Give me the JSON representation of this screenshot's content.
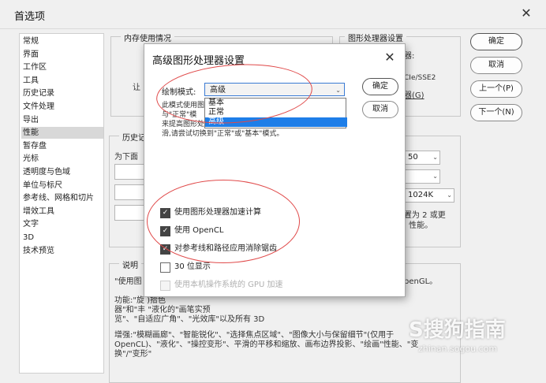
{
  "prefs": {
    "title": "首选项",
    "sidebar": [
      "常规",
      "界面",
      "工作区",
      "工具",
      "历史记录",
      "文件处理",
      "导出",
      "性能",
      "暂存盘",
      "光标",
      "透明度与色域",
      "单位与标尺",
      "参考线、网格和切片",
      "增效工具",
      "文字",
      "3D",
      "技术预览"
    ],
    "selected_index": 7,
    "groups": {
      "memory": "内存使用情况",
      "history": "历史记",
      "gpu": "图形处理器设置",
      "desc": "说明"
    },
    "buttons": {
      "ok": "确定",
      "cancel": "取消",
      "prev": "上一个(P)",
      "next": "下一个(N)"
    },
    "ghost_texts": {
      "gpu_tail": "器:",
      "cie": "CIe/SSE2",
      "settings_link": "器(G)",
      "let": "让",
      "for_below": "为下面",
      "val_50": "50",
      "val_1024": "1024K",
      "set_2": "置为 2 或更",
      "perf": "J 性能。",
      "opengl_tail": "penGL。",
      "desc_1": "\"使用图",
      "desc_2": "功能:\"旋                                                           )拾色",
      "desc_3": "器\"和\"丰                                                  \"液化的\"画笔实预",
      "desc_4": "览\"、\"自适应广角\"、\"光效库\"以及所有 3D",
      "desc_5": "增强:\"模糊画廊\"、\"智能锐化\"、\"选择焦点区域\"、\"图像大小与保留细节\"(仅用于",
      "desc_6": "OpenCL)、\"液化\"、\"操控变形\"、平滑的平移和缩放、画布边界投影、\"绘画\"性能、\"变",
      "desc_7": "换\"/\"变形\""
    }
  },
  "dialog": {
    "title": "高级图形处理器设置",
    "mode_label": "绘制模式:",
    "mode_value": "高级",
    "mode_options": [
      "基本",
      "正常",
      "高级"
    ],
    "ok": "确定",
    "cancel": "取消",
    "desc_lines": [
      "此模式使用图",
      "与\"正常\"模",
      "来提高图形处理器性能",
      "滑,请尝试切换到\"正常\"或\"基本\"模式。"
    ],
    "checkboxes": [
      {
        "label": "使用图形处理器加速计算",
        "checked": true,
        "disabled": false
      },
      {
        "label": "使用 OpenCL",
        "checked": true,
        "disabled": false
      },
      {
        "label": "对参考线和路径应用消除锯齿",
        "checked": true,
        "disabled": false
      },
      {
        "label": "30 位显示",
        "checked": false,
        "disabled": false
      },
      {
        "label": "使用本机操作系统的 GPU 加速",
        "checked": false,
        "disabled": true
      }
    ]
  },
  "watermark": {
    "main": "S搜狗指南",
    "sub": "zhinan.sogou.com"
  },
  "colors": {
    "annotation": "#e04a4a",
    "selection": "#1e7ee8"
  }
}
